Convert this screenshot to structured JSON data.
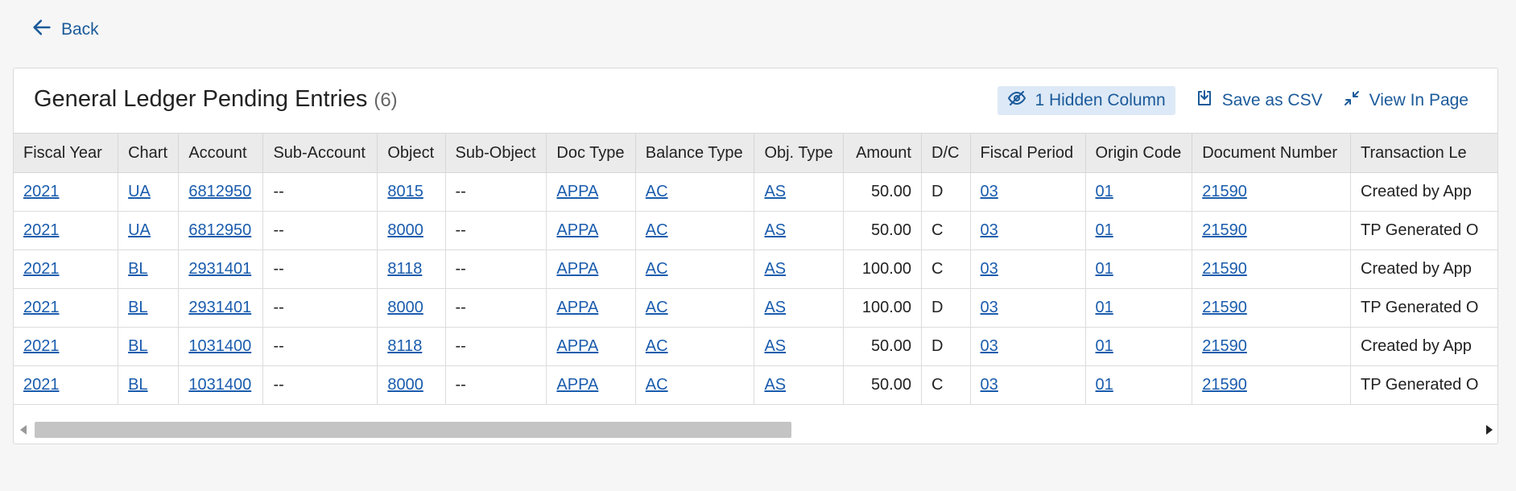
{
  "back": {
    "label": "Back"
  },
  "panel": {
    "title": "General Ledger Pending Entries",
    "count": "(6)"
  },
  "actions": {
    "hidden_columns": "1 Hidden Column",
    "save_csv": "Save as CSV",
    "view_in_page": "View In Page"
  },
  "columns": [
    "Fiscal Year",
    "Chart",
    "Account",
    "Sub-Account",
    "Object",
    "Sub-Object",
    "Doc Type",
    "Balance Type",
    "Obj. Type",
    "Amount",
    "D/C",
    "Fiscal Period",
    "Origin Code",
    "Document Number",
    "Transaction Le"
  ],
  "rows": [
    [
      "2021",
      "UA",
      "6812950",
      "--",
      "8015",
      "--",
      "APPA",
      "AC",
      "AS",
      "50.00",
      "D",
      "03",
      "01",
      "21590",
      "Created by App"
    ],
    [
      "2021",
      "UA",
      "6812950",
      "--",
      "8000",
      "--",
      "APPA",
      "AC",
      "AS",
      "50.00",
      "C",
      "03",
      "01",
      "21590",
      "TP Generated O"
    ],
    [
      "2021",
      "BL",
      "2931401",
      "--",
      "8118",
      "--",
      "APPA",
      "AC",
      "AS",
      "100.00",
      "C",
      "03",
      "01",
      "21590",
      "Created by App"
    ],
    [
      "2021",
      "BL",
      "2931401",
      "--",
      "8000",
      "--",
      "APPA",
      "AC",
      "AS",
      "100.00",
      "D",
      "03",
      "01",
      "21590",
      "TP Generated O"
    ],
    [
      "2021",
      "BL",
      "1031400",
      "--",
      "8118",
      "--",
      "APPA",
      "AC",
      "AS",
      "50.00",
      "D",
      "03",
      "01",
      "21590",
      "Created by App"
    ],
    [
      "2021",
      "BL",
      "1031400",
      "--",
      "8000",
      "--",
      "APPA",
      "AC",
      "AS",
      "50.00",
      "C",
      "03",
      "01",
      "21590",
      "TP Generated O"
    ]
  ],
  "link_columns": [
    0,
    1,
    2,
    4,
    6,
    7,
    8,
    11,
    12,
    13
  ],
  "numeric_columns": [
    9
  ],
  "icons": {
    "back": "arrow-left-icon",
    "hidden": "eye-slash-icon",
    "csv": "download-icon",
    "view": "collapse-icon"
  },
  "colors": {
    "link": "#1a5cad",
    "accent": "#1b5a9a",
    "header_bg": "#ebebeb",
    "chip_bg": "#dde9f6"
  }
}
